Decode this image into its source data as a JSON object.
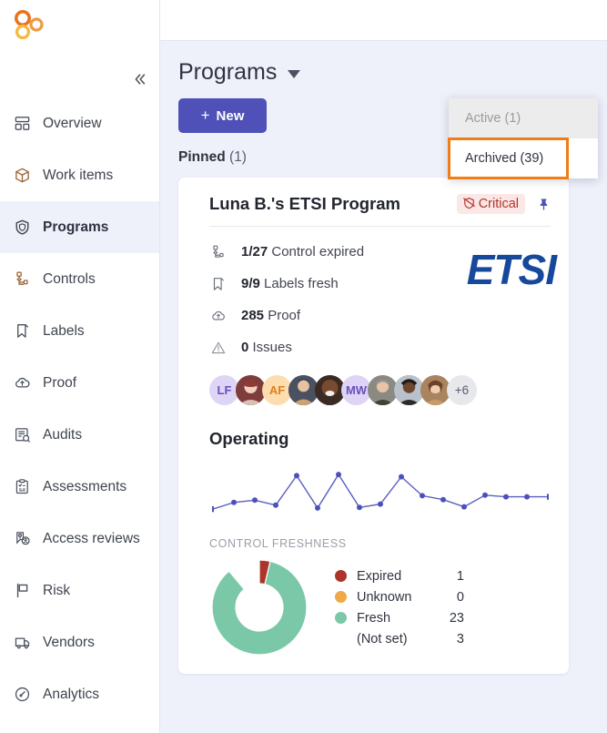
{
  "sidebar": {
    "logo_name": "app-logo",
    "collapse_label": "«",
    "items": [
      {
        "label": "Overview",
        "icon": "dashboard-icon",
        "active": false
      },
      {
        "label": "Work items",
        "icon": "package-icon",
        "active": false
      },
      {
        "label": "Programs",
        "icon": "shield-icon",
        "active": true
      },
      {
        "label": "Controls",
        "icon": "hierarchy-icon",
        "active": false
      },
      {
        "label": "Labels",
        "icon": "bookmark-icon",
        "active": false
      },
      {
        "label": "Proof",
        "icon": "cloud-upload-icon",
        "active": false
      },
      {
        "label": "Audits",
        "icon": "audit-search-icon",
        "active": false
      },
      {
        "label": "Assessments",
        "icon": "clipboard-check-icon",
        "active": false
      },
      {
        "label": "Access reviews",
        "icon": "key-user-icon",
        "active": false
      },
      {
        "label": "Risk",
        "icon": "flag-icon",
        "active": false
      },
      {
        "label": "Vendors",
        "icon": "truck-icon",
        "active": false
      },
      {
        "label": "Analytics",
        "icon": "gauge-icon",
        "active": false
      }
    ]
  },
  "header": {
    "title": "Programs",
    "caret_icon": "chevron-down-icon",
    "new_button": "New",
    "new_button_plus": "+"
  },
  "dropdown": {
    "items": [
      {
        "label": "Active (1)",
        "state": "disabled"
      },
      {
        "label": "Archived (39)",
        "state": "highlight"
      }
    ]
  },
  "pinned": {
    "label": "Pinned",
    "count": "(1)"
  },
  "card": {
    "title": "Luna B.'s ETSI Program",
    "badge": {
      "label": "Critical",
      "icon": "shield-off-icon",
      "bg": "#fbe7e6",
      "color": "#b4342b"
    },
    "pin_icon": "pin-icon",
    "logo_text": "ETSI",
    "stats": [
      {
        "icon": "hierarchy-icon",
        "value": "1/27",
        "label": "Control expired"
      },
      {
        "icon": "bookmark-icon",
        "value": "9/9",
        "label": "Labels fresh"
      },
      {
        "icon": "cloud-upload-icon",
        "value": "285",
        "label": "Proof"
      },
      {
        "icon": "warning-icon",
        "value": "0",
        "label": "Issues"
      }
    ],
    "avatars": [
      {
        "type": "initials",
        "text": "LF",
        "bg": "#ded4f5",
        "color": "#6a4fbd"
      },
      {
        "type": "photo",
        "text": "",
        "bg": "#c5998c",
        "color": "#ffffff"
      },
      {
        "type": "initials",
        "text": "AF",
        "bg": "#fbddb0",
        "color": "#e07f1e"
      },
      {
        "type": "photo",
        "text": "",
        "bg": "#b98f6f",
        "color": "#ffffff"
      },
      {
        "type": "photo",
        "text": "",
        "bg": "#4f3028",
        "color": "#ffffff"
      },
      {
        "type": "initials",
        "text": "MW",
        "bg": "#ded4f5",
        "color": "#6a4fbd"
      },
      {
        "type": "photo",
        "text": "",
        "bg": "#8d8a84",
        "color": "#ffffff"
      },
      {
        "type": "photo",
        "text": "",
        "bg": "#6a5246",
        "color": "#ffffff"
      },
      {
        "type": "photo",
        "text": "",
        "bg": "#c09a79",
        "color": "#ffffff"
      },
      {
        "type": "more",
        "text": "+6",
        "bg": "#e7e8ec",
        "color": "#5b6070"
      }
    ],
    "operating_title": "Operating",
    "chart_label": "CONTROL FRESHNESS"
  },
  "chart_data": [
    {
      "type": "line",
      "title": "Operating",
      "xlabel": "",
      "ylabel": "",
      "x": [
        0,
        1,
        2,
        3,
        4,
        5,
        6,
        7,
        8,
        9,
        10,
        11,
        12,
        13,
        14,
        15,
        16
      ],
      "values": [
        8,
        20,
        24,
        15,
        68,
        10,
        70,
        11,
        17,
        66,
        32,
        25,
        12,
        33,
        30,
        30,
        30
      ],
      "ylim": [
        0,
        80
      ],
      "grid": false,
      "legend": "none",
      "line_color": "#5a5fc0",
      "marker_color": "#4b51bb"
    },
    {
      "type": "pie",
      "title": "CONTROL FRESHNESS",
      "donut": true,
      "categories": [
        "Expired",
        "Unknown",
        "Fresh",
        "(Not set)"
      ],
      "values": [
        1,
        0,
        23,
        3
      ],
      "slice_colors": [
        "#ac342a",
        "#f0a84a",
        "#7ac8a8",
        ""
      ],
      "legend": "right",
      "note": "donut renders Expired and Fresh only; (Not set) has no swatch"
    }
  ]
}
